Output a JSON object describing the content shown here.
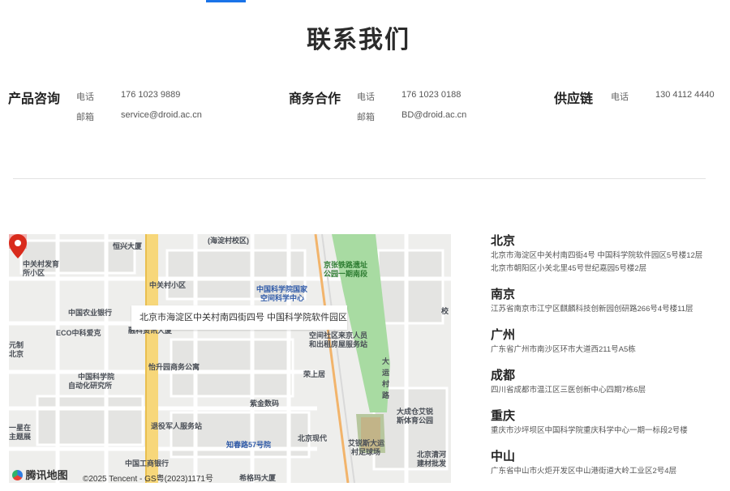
{
  "page": {
    "title": "联系我们"
  },
  "contacts": [
    {
      "title": "产品咨询",
      "rows": [
        {
          "label": "电话",
          "value": "176 1023 9889"
        },
        {
          "label": "邮箱",
          "value": "service@droid.ac.cn"
        }
      ]
    },
    {
      "title": "商务合作",
      "rows": [
        {
          "label": "电话",
          "value": "176 1023 0188"
        },
        {
          "label": "邮箱",
          "value": "BD@droid.ac.cn"
        }
      ]
    },
    {
      "title": "供应链",
      "rows": [
        {
          "label": "电话",
          "value": "130 4112 4440"
        }
      ]
    }
  ],
  "map": {
    "tooltip": "北京市海淀区中关村南四街四号 中国科学院软件园区",
    "logo": "腾讯地图",
    "copyright": "©2025 Tencent - GS粤(2023)1171号",
    "labels": [
      "(海淀村校区)",
      "恒兴大厦",
      "中关村发育",
      "所小区",
      "中关村小区",
      "中国科学院国家",
      "空间科学中心",
      "中国农业银行",
      "ECO中科爱克",
      "融科资讯大厦",
      "空间社区来京人员",
      "和出租房屋服务站",
      "怡升园商务公寓",
      "中国科学院",
      "自动化研究所",
      "荣上居",
      "紫金数码",
      "退役军人服务站",
      "北京现代",
      "知春路57号院",
      "中国工商银行",
      "希格玛大厦",
      "京张铁路遗址",
      "公园一期南段",
      "大运村路",
      "大成仓艾锐",
      "斯体育公园",
      "艾锐斯大运",
      "村足球场",
      "北京清河",
      "建材批发",
      "校",
      "元制",
      "北京",
      "一星在",
      "主题展"
    ]
  },
  "offices": [
    {
      "city": "北京",
      "lines": [
        "北京市海淀区中关村南四街4号 中国科学院软件园区5号楼12层",
        "北京市朝阳区小关北里45号世纪嘉园5号楼2层"
      ]
    },
    {
      "city": "南京",
      "lines": [
        "江苏省南京市江宁区麒麟科技创新园创研路266号4号楼11层"
      ]
    },
    {
      "city": "广州",
      "lines": [
        "广东省广州市南沙区环市大道西211号A5栋"
      ]
    },
    {
      "city": "成都",
      "lines": [
        "四川省成都市温江区三医创新中心四期7栋6层"
      ]
    },
    {
      "city": "重庆",
      "lines": [
        "重庆市沙坪坝区中国科学院重庆科学中心一期一标段2号楼"
      ]
    },
    {
      "city": "中山",
      "lines": [
        "广东省中山市火炬开发区中山港街道大岭工业区2号4层"
      ]
    }
  ]
}
